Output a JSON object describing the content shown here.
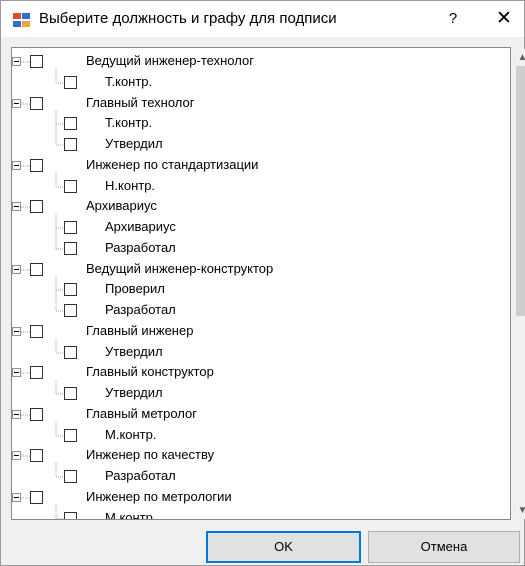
{
  "window": {
    "title": "Выберите должность и графу для подписи",
    "help_glyph": "?",
    "close_glyph": "✕"
  },
  "tree": {
    "nodes": [
      {
        "label": "Ведущий инженер-технолог",
        "children": [
          "Т.контр."
        ]
      },
      {
        "label": "Главный технолог",
        "children": [
          "Т.контр.",
          "Утвердил"
        ]
      },
      {
        "label": "Инженер по стандартизации",
        "children": [
          "Н.контр."
        ]
      },
      {
        "label": "Архивариус",
        "children": [
          "Архивариус",
          "Разработал"
        ]
      },
      {
        "label": "Ведущий инженер-конструктор",
        "children": [
          "Проверил",
          "Разработал"
        ]
      },
      {
        "label": "Главный инженер",
        "children": [
          "Утвердил"
        ]
      },
      {
        "label": "Главный конструктор",
        "children": [
          "Утвердил"
        ]
      },
      {
        "label": "Главный метролог",
        "children": [
          "М.контр."
        ]
      },
      {
        "label": "Инженер по качеству",
        "children": [
          "Разработал"
        ]
      },
      {
        "label": "Инженер по метрологии",
        "children": [
          "М.контр."
        ]
      }
    ]
  },
  "scrollbar": {
    "up_glyph": "▲",
    "down_glyph": "▼"
  },
  "buttons": {
    "ok_label": "OK",
    "cancel_label": "Отмена"
  },
  "colors": {
    "accent": "#0078d7",
    "icon_blue": "#2d6fd1",
    "icon_red": "#e04a2f",
    "icon_orange": "#f2a33a"
  }
}
